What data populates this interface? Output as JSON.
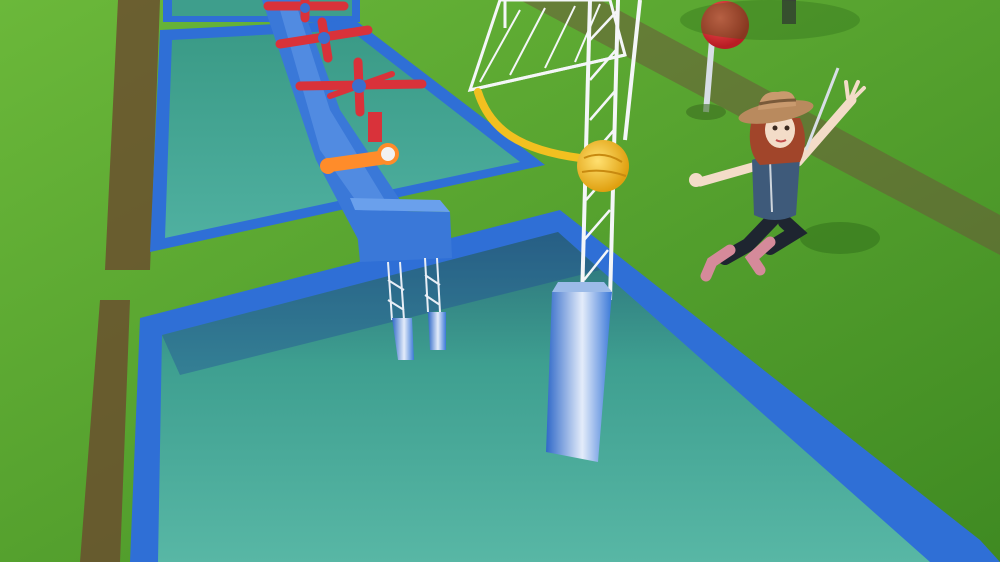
{
  "scene": {
    "title": "",
    "description_visible_text": []
  },
  "palette": {
    "grass": "#5aa832",
    "grass_dark": "#3f8a22",
    "dirt": "#6b4a2e",
    "pool_rim": "#2f6fd6",
    "water": "#3e9e8c",
    "water_deep": "#2c7f74",
    "platform_blue": "#3a78d8",
    "platform_white": "#e8f0ff",
    "spinner_red": "#d9323a",
    "rope_yellow": "#f2c020",
    "tower_white": "#f4f6f8",
    "skin": "#f3dcc8",
    "hat": "#c99a6e",
    "hair": "#a1452a",
    "vest": "#3e5a7a",
    "boots": "#d58a9a"
  },
  "objects": {
    "target_ball": "red-target-ball",
    "swing_ball": "yellow-swing-ball",
    "character": "cowgirl-contestant"
  }
}
